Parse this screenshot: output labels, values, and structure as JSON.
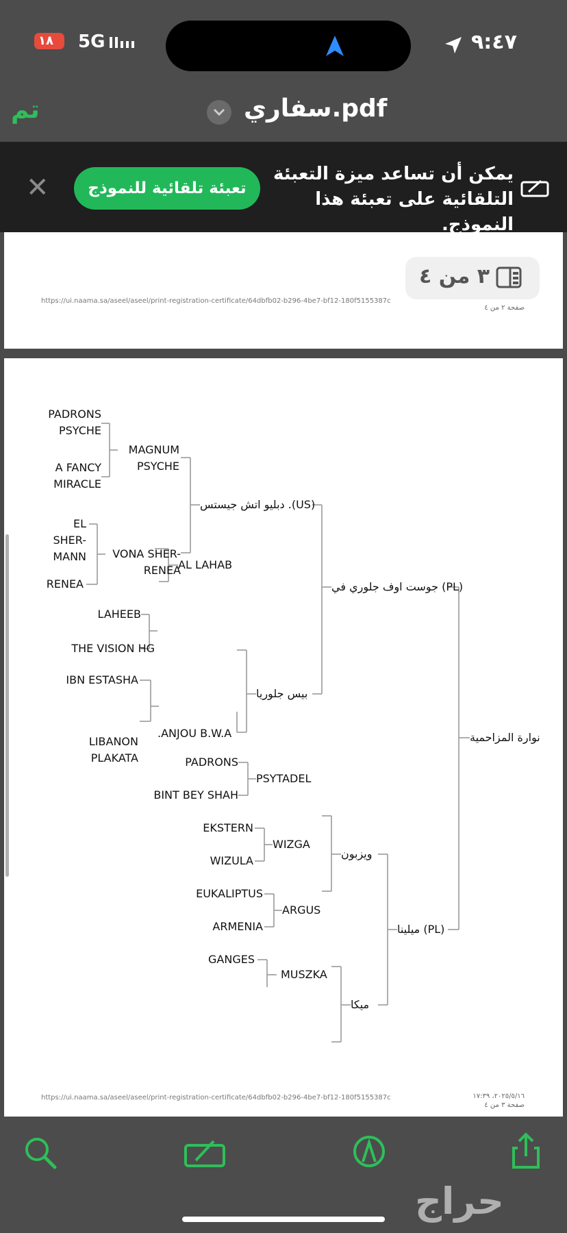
{
  "status": {
    "time": "٩:٤٧",
    "network": "5G",
    "battery": "١٨"
  },
  "nav": {
    "done_label": "تم",
    "file_title": "سفاري.pdf"
  },
  "banner": {
    "message": "يمكن أن تساعد ميزة التعبئة التلقائية على تعبئة هذا النموذج.",
    "fill_button": "تعبئة تلقائية للنموذج"
  },
  "pager": {
    "label": "٣ من ٤"
  },
  "page2": {
    "url": "https://ui.naama.sa/aseel/aseel/print-registration-certificate/64dbfb02-b296-4be7-bf12-180f5155387c",
    "page_label": "صفحة ٢ من ٤"
  },
  "page3": {
    "url": "https://ui.naama.sa/aseel/aseel/print-registration-certificate/64dbfb02-b296-4be7-bf12-180f5155387c",
    "timestamp": "٢٠٢٥/٥/١٦، ١٧:٣٩",
    "page_label": "صفحة ٣ من ٤"
  },
  "pedigree": {
    "subject": "نوارة المزاحمية",
    "sire": "جوست اوف جلوري في (PL)",
    "dam": "ميلينا (PL)",
    "sire_sire": "دبليو اتش جيستس .(US)",
    "sire_dam": "بيس جلوريا",
    "dam_sire": "ويزبون",
    "dam_dam": "ميكا",
    "g3": [
      "MAGNUM PSYCHE",
      "VONA SHER-RENEA",
      "AL LAHAB",
      ".ANJOU B.W.A",
      "PSYTADEL",
      "WIZGA",
      "ARGUS",
      "MUSZKA"
    ],
    "g4": [
      "PADRONS PSYCHE",
      "A FANCY MIRACLE",
      "EL SHER-MANN",
      "RENEA",
      "LAHEEB",
      "THE VISION HG",
      "IBN ESTASHA",
      "LIBANON PLAKATA",
      "PADRONS",
      "BINT BEY SHAH",
      "EKSTERN",
      "WIZULA",
      "EUKALIPTUS",
      "ARMENIA",
      "GANGES"
    ]
  },
  "toolbar": {
    "icons": [
      "search-icon",
      "markup-icon",
      "annotate-icon",
      "share-icon"
    ]
  },
  "watermark": "حراج",
  "colors": {
    "accent": "#22b85a",
    "banner_bg": "#1f1f1f",
    "chrome_bg": "#4c4c4c"
  }
}
